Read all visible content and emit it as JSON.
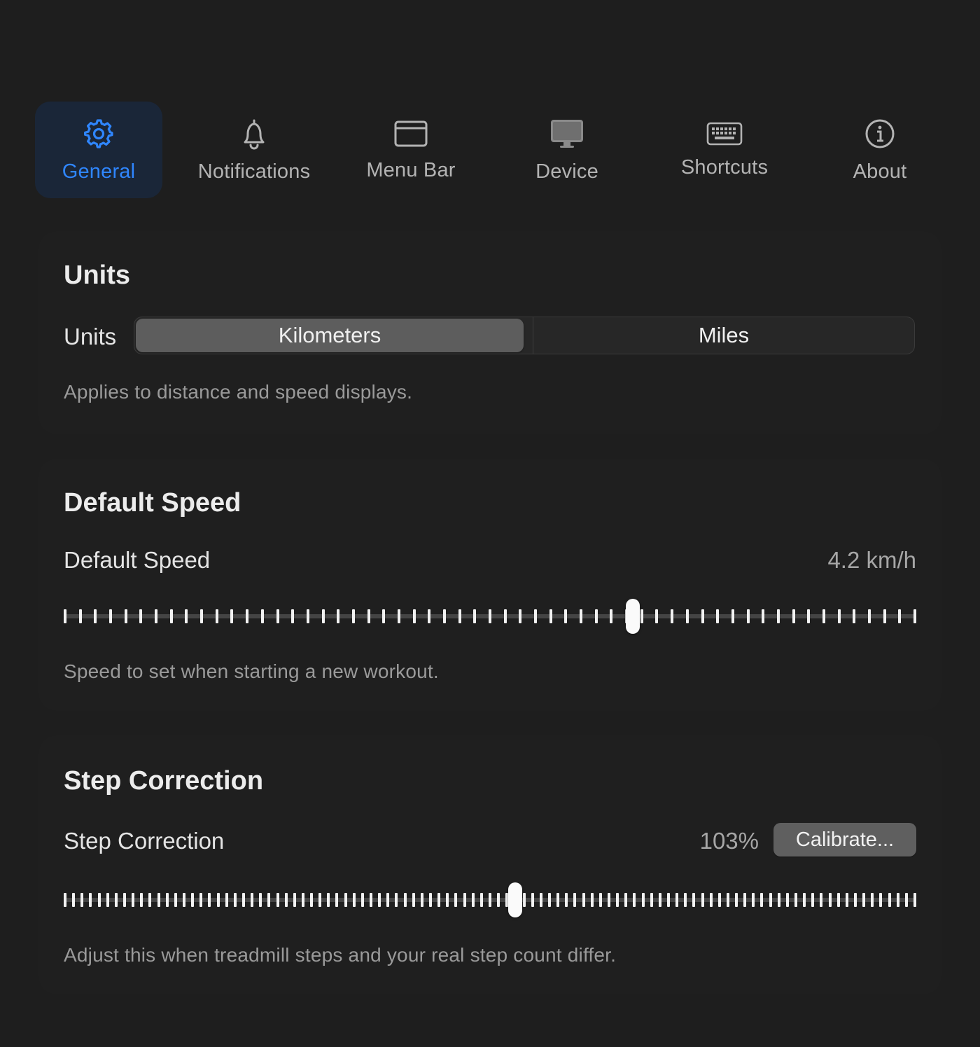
{
  "toolbar": {
    "tabs": [
      {
        "label": "General",
        "icon": "gear-icon",
        "active": true
      },
      {
        "label": "Notifications",
        "icon": "bell-icon",
        "active": false
      },
      {
        "label": "Menu Bar",
        "icon": "window-icon",
        "active": false
      },
      {
        "label": "Device",
        "icon": "display-icon",
        "active": false
      },
      {
        "label": "Shortcuts",
        "icon": "keyboard-icon",
        "active": false
      },
      {
        "label": "About",
        "icon": "info-icon",
        "active": false
      }
    ]
  },
  "units_section": {
    "title": "Units",
    "row_label": "Units",
    "options": [
      "Kilometers",
      "Miles"
    ],
    "selected": "Kilometers",
    "caption": "Applies to distance and speed displays."
  },
  "speed_section": {
    "title": "Default Speed",
    "row_label": "Default Speed",
    "value_text": "4.2 km/h",
    "slider_fraction": 0.67,
    "tick_count": 57,
    "caption": "Speed to set when starting a new workout."
  },
  "step_section": {
    "title": "Step Correction",
    "row_label": "Step Correction",
    "value_text": "103%",
    "calibrate_label": "Calibrate...",
    "slider_fraction": 0.53,
    "tick_count": 101,
    "caption": "Adjust this when treadmill steps and your real step count differ."
  },
  "colors": {
    "accent": "#2f86ff",
    "background": "#1e1e1e",
    "active_tab_bg": "#1a2638"
  }
}
